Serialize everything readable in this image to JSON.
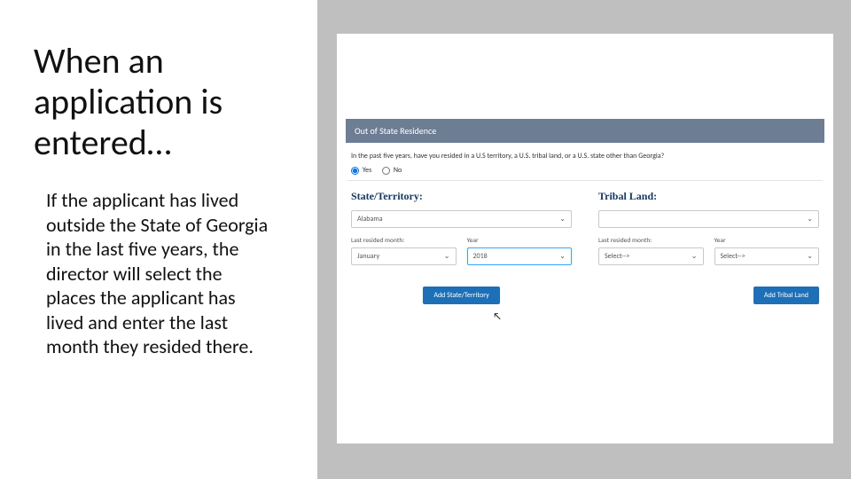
{
  "title": "When an application is entered…",
  "body": "If the applicant has lived outside the State of Georgia in the last five years, the director will select the places the applicant has lived and enter the last month they resided there.",
  "panel_header": "Out of State Residence",
  "question": "In the past five years, have you resided in a U.S territory, a U.S. tribal land, or a U.S. state other than Georgia?",
  "options": {
    "yes": "Yes",
    "no": "No"
  },
  "state": {
    "heading": "State/Territory:",
    "selected": "Alabama",
    "month_label": "Last resided month:",
    "year_label": "Year",
    "month_value": "January",
    "year_value": "2018",
    "button": "Add State/Territory"
  },
  "tribal": {
    "heading": "Tribal Land:",
    "selected_placeholder": " ",
    "month_label": "Last resided month:",
    "year_label": "Year",
    "month_value": "Select-->",
    "year_value": "Select-->",
    "button": "Add Tribal Land"
  }
}
